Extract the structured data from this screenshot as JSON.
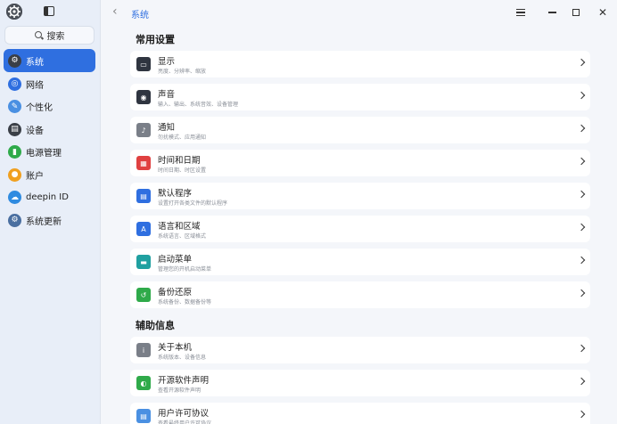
{
  "sidebar": {
    "search_label": "搜索",
    "items": [
      {
        "label": "系统",
        "icon": "system-icon",
        "color": "#3a3f47",
        "active": true
      },
      {
        "label": "网络",
        "icon": "network-globe-icon",
        "color": "#2f6fe0"
      },
      {
        "label": "个性化",
        "icon": "personalization-brush-icon",
        "color": "#4a90e2"
      },
      {
        "label": "设备",
        "icon": "device-keyboard-icon",
        "color": "#3a3f47"
      },
      {
        "label": "电源管理",
        "icon": "power-battery-icon",
        "color": "#2faa4a"
      },
      {
        "label": "账户",
        "icon": "account-user-icon",
        "color": "#f0a020"
      },
      {
        "label": "deepin ID",
        "icon": "cloud-icon",
        "color": "#2f8be0"
      },
      {
        "label": "系统更新",
        "icon": "update-gear-icon",
        "color": "#4a6fa0"
      }
    ]
  },
  "header": {
    "breadcrumb": "系统"
  },
  "sections": [
    {
      "title": "常用设置",
      "items": [
        {
          "title": "显示",
          "subtitle": "亮度、分辨率、缩放",
          "icon": "display-monitor-icon",
          "color": "#2f3540"
        },
        {
          "title": "声音",
          "subtitle": "输入、输出、系统音效、设备管理",
          "icon": "sound-speaker-icon",
          "color": "#2f3540"
        },
        {
          "title": "通知",
          "subtitle": "勿扰模式、应用通知",
          "icon": "notification-bell-icon",
          "color": "#7a7f88"
        },
        {
          "title": "时间和日期",
          "subtitle": "时间日期、时区设置",
          "icon": "calendar-icon",
          "color": "#e04040"
        },
        {
          "title": "默认程序",
          "subtitle": "设置打开各类文件的默认程序",
          "icon": "default-apps-icon",
          "color": "#2f6fe0"
        },
        {
          "title": "语言和区域",
          "subtitle": "系统语言、区域格式",
          "icon": "language-icon",
          "color": "#2f6fe0"
        },
        {
          "title": "启动菜单",
          "subtitle": "管理您的开机启动菜单",
          "icon": "boot-menu-icon",
          "color": "#20a0a0"
        },
        {
          "title": "备份还原",
          "subtitle": "系统备份、数据备份等",
          "icon": "backup-restore-icon",
          "color": "#2faa4a"
        }
      ]
    },
    {
      "title": "辅助信息",
      "items": [
        {
          "title": "关于本机",
          "subtitle": "系统版本、设备信息",
          "icon": "info-icon",
          "color": "#7a7f88"
        },
        {
          "title": "开源软件声明",
          "subtitle": "查看开源软件声明",
          "icon": "open-source-icon",
          "color": "#2faa4a"
        },
        {
          "title": "用户许可协议",
          "subtitle": "查看最终用户许可协议",
          "icon": "license-document-icon",
          "color": "#4a90e2"
        }
      ]
    }
  ]
}
